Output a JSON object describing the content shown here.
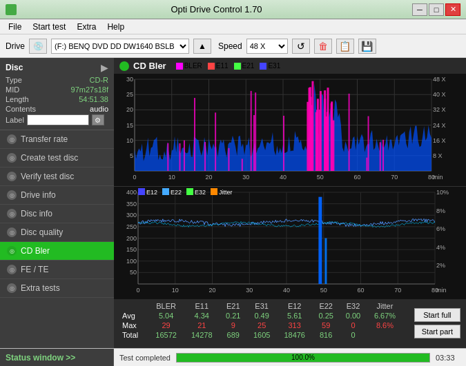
{
  "titlebar": {
    "title": "Opti Drive Control 1.70",
    "min_label": "─",
    "max_label": "□",
    "close_label": "✕"
  },
  "menu": {
    "items": [
      "File",
      "Start test",
      "Extra",
      "Help"
    ]
  },
  "drive": {
    "label": "Drive",
    "value": "(F:)  BENQ DVD DD DW1640 BSLB",
    "speed_label": "Speed",
    "speed_value": "48 X"
  },
  "disc": {
    "title": "Disc",
    "type_label": "Type",
    "type_value": "CD-R",
    "mid_label": "MID",
    "mid_value": "97m27s18f",
    "length_label": "Length",
    "length_value": "54:51.38",
    "contents_label": "Contents",
    "contents_value": "audio",
    "label_label": "Label"
  },
  "nav": {
    "items": [
      {
        "id": "transfer-rate",
        "label": "Transfer rate",
        "active": false
      },
      {
        "id": "create-test-disc",
        "label": "Create test disc",
        "active": false
      },
      {
        "id": "verify-test-disc",
        "label": "Verify test disc",
        "active": false
      },
      {
        "id": "drive-info",
        "label": "Drive info",
        "active": false
      },
      {
        "id": "disc-info",
        "label": "Disc info",
        "active": false
      },
      {
        "id": "disc-quality",
        "label": "Disc quality",
        "active": false
      },
      {
        "id": "cd-bler",
        "label": "CD Bler",
        "active": true
      },
      {
        "id": "fe-te",
        "label": "FE / TE",
        "active": false
      },
      {
        "id": "extra-tests",
        "label": "Extra tests",
        "active": false
      }
    ]
  },
  "chart1": {
    "title": "CD Bler",
    "legend": [
      {
        "label": "BLER",
        "color": "#ff00ff"
      },
      {
        "label": "E11",
        "color": "#ff4444"
      },
      {
        "label": "E21",
        "color": "#44ff44"
      },
      {
        "label": "E31",
        "color": "#4444ff"
      }
    ],
    "y_labels": [
      "30",
      "25",
      "20",
      "15",
      "10",
      "5"
    ],
    "x_labels": [
      "0",
      "10",
      "20",
      "30",
      "40",
      "50",
      "60",
      "70",
      "80 min"
    ],
    "y_right_labels": [
      "48 X",
      "40 X",
      "32 X",
      "24 X",
      "16 X",
      "8 X"
    ]
  },
  "chart2": {
    "legend": [
      {
        "label": "E12",
        "color": "#4444ff"
      },
      {
        "label": "E22",
        "color": "#44aaff"
      },
      {
        "label": "E32",
        "color": "#44ff44"
      },
      {
        "label": "Jitter",
        "color": "#ff8800"
      }
    ],
    "y_labels": [
      "400",
      "350",
      "300",
      "250",
      "200",
      "150",
      "100",
      "50"
    ],
    "x_labels": [
      "0",
      "10",
      "20",
      "30",
      "40",
      "50",
      "60",
      "70",
      "80 min"
    ],
    "y_right_labels": [
      "10%",
      "8%",
      "6%",
      "4%",
      "2%"
    ]
  },
  "stats": {
    "headers": [
      "",
      "BLER",
      "E11",
      "E21",
      "E31",
      "E12",
      "E22",
      "E32",
      "Jitter"
    ],
    "rows": [
      {
        "label": "Avg",
        "values": [
          "5.04",
          "4.34",
          "0.21",
          "0.49",
          "5.61",
          "0.25",
          "0.00",
          "6.67%"
        ]
      },
      {
        "label": "Max",
        "values": [
          "29",
          "21",
          "9",
          "25",
          "313",
          "59",
          "0",
          "8.6%"
        ]
      },
      {
        "label": "Total",
        "values": [
          "16572",
          "14278",
          "689",
          "1605",
          "18476",
          "816",
          "0",
          ""
        ]
      }
    ],
    "btn_start_full": "Start full",
    "btn_start_part": "Start part"
  },
  "statusbar": {
    "sidebar_text": "Status window >>",
    "status_text": "Test completed",
    "progress_pct": 100,
    "progress_label": "100.0%",
    "time": "03:33"
  }
}
